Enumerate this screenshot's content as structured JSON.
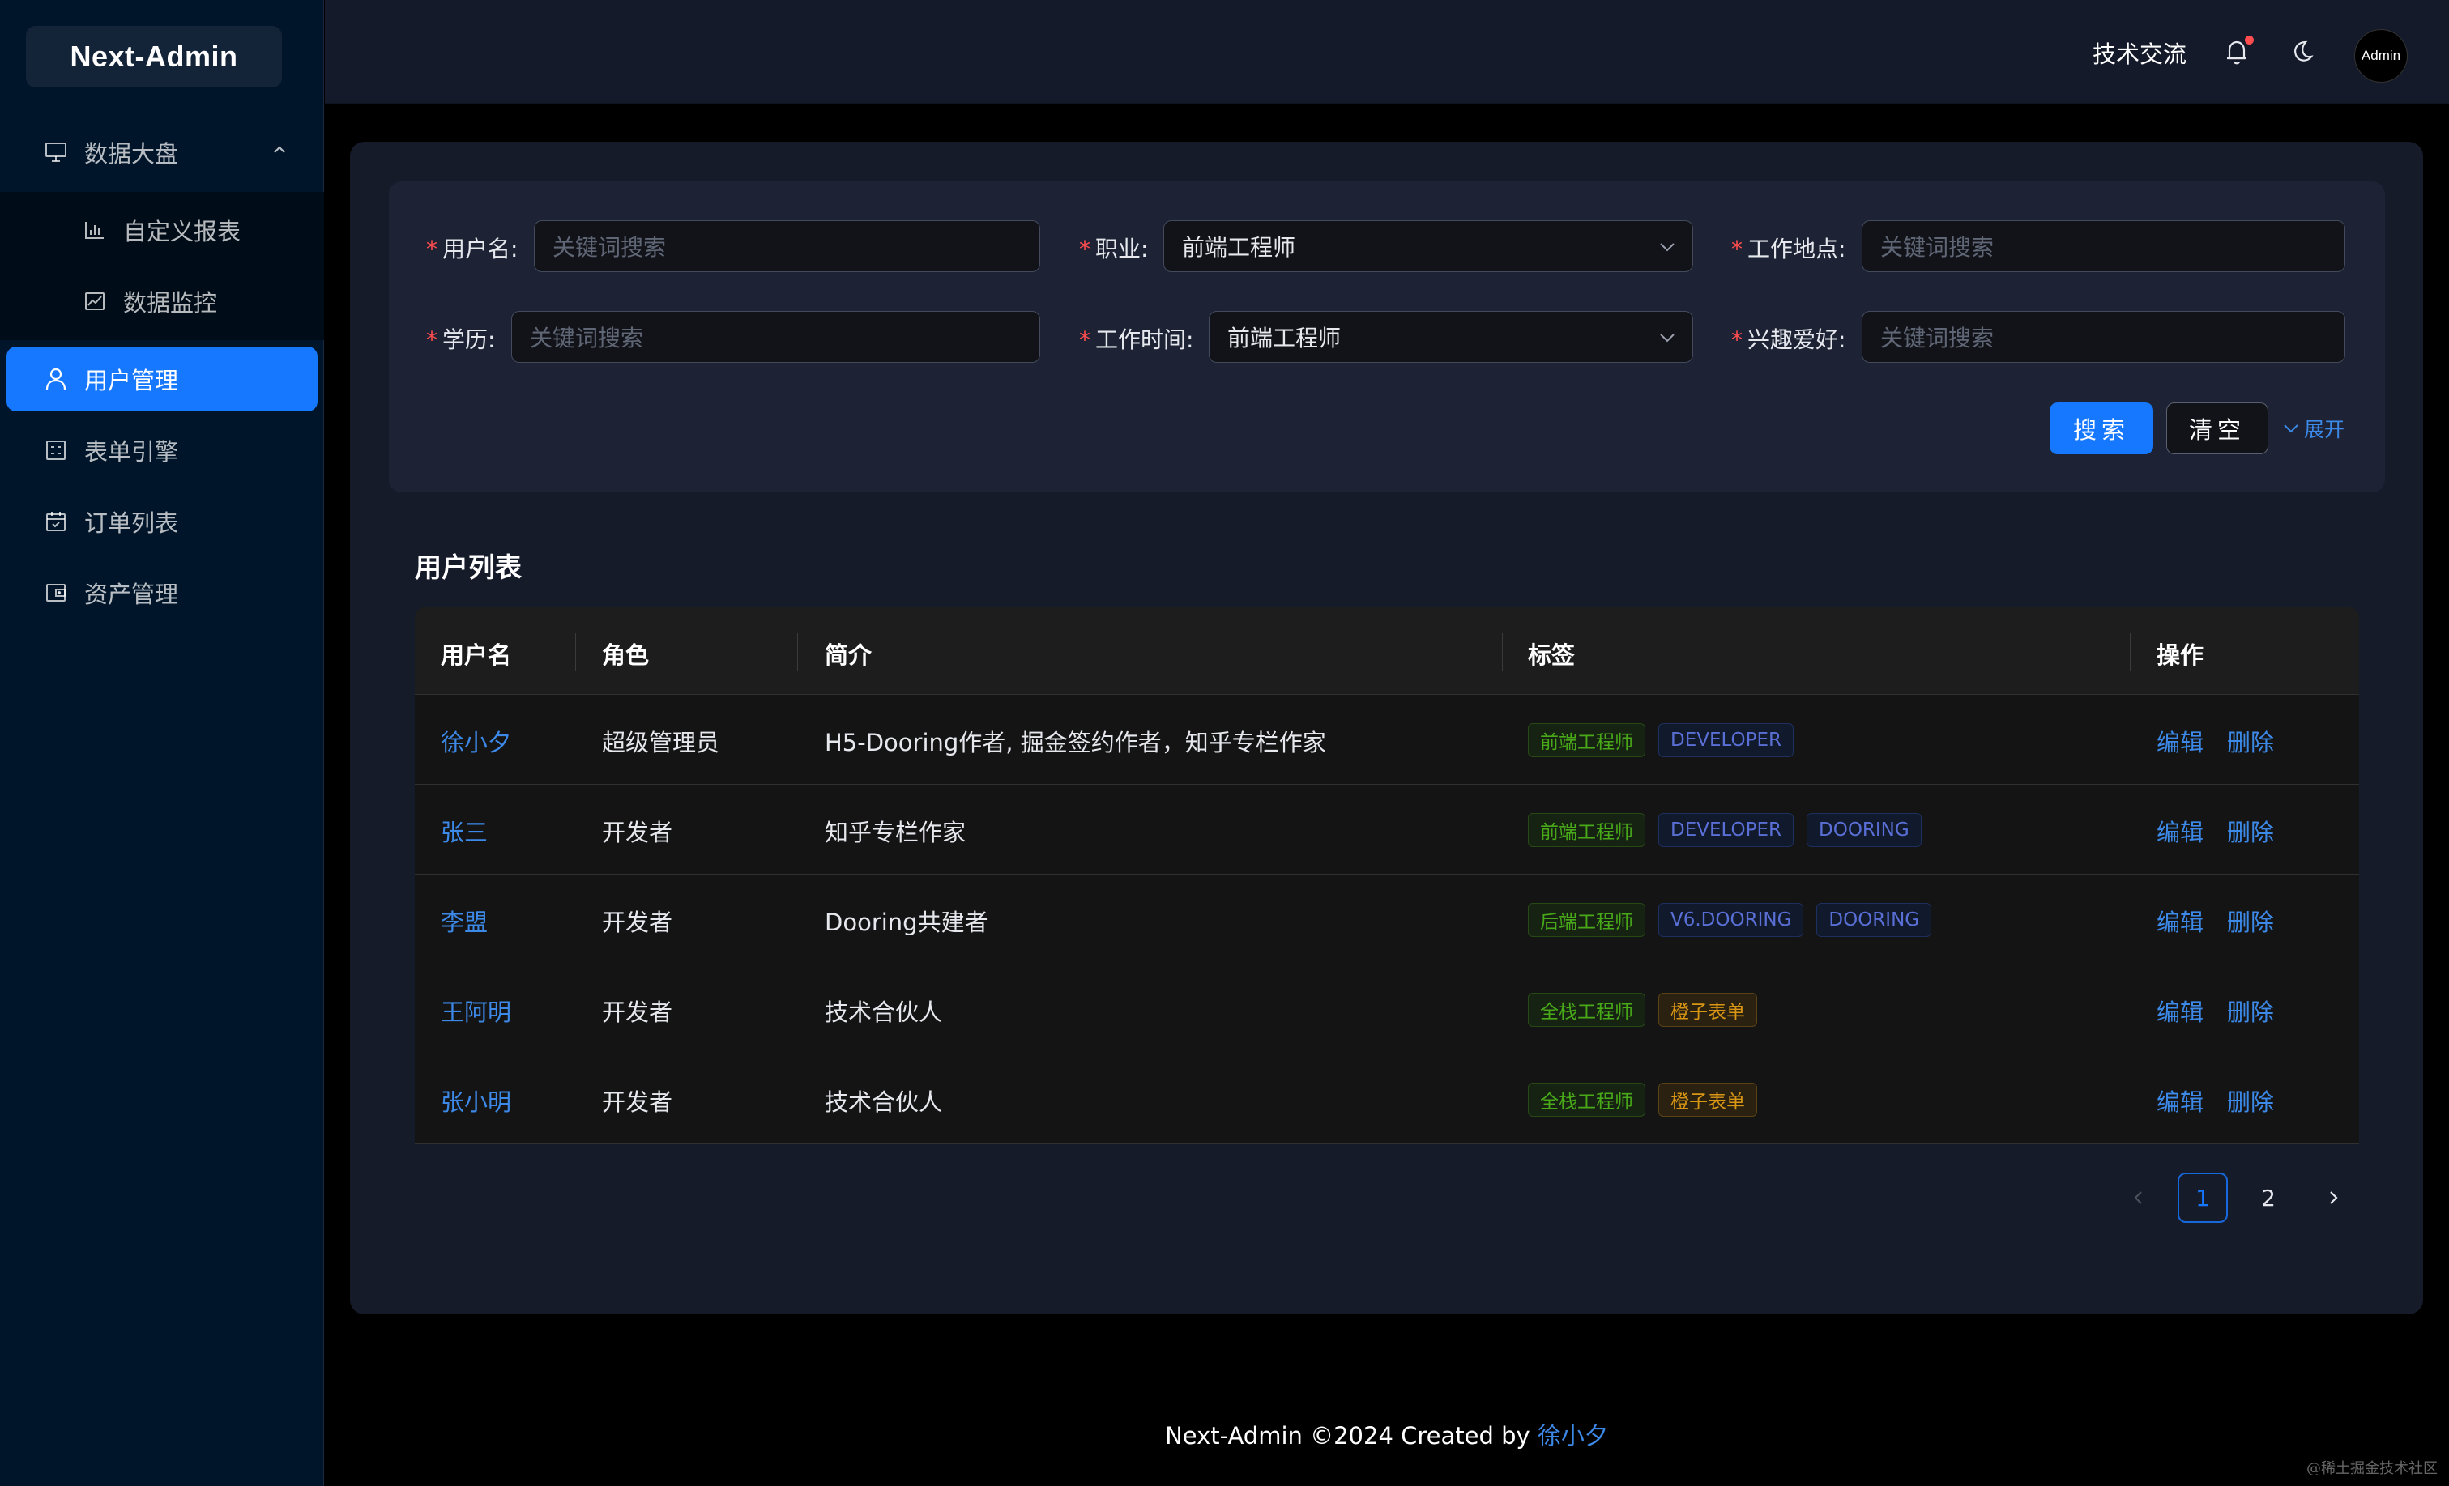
{
  "app": {
    "logo": "Next-Admin"
  },
  "sidebar": {
    "items": [
      {
        "label": "数据大盘",
        "icon": "monitor-icon"
      },
      {
        "label": "自定义报表",
        "icon": "bar-chart-icon"
      },
      {
        "label": "数据监控",
        "icon": "line-chart-icon"
      },
      {
        "label": "用户管理",
        "icon": "user-icon",
        "active": true
      },
      {
        "label": "表单引擎",
        "icon": "form-icon"
      },
      {
        "label": "订单列表",
        "icon": "calendar-icon"
      },
      {
        "label": "资产管理",
        "icon": "wallet-icon"
      }
    ]
  },
  "header": {
    "link": "技术交流",
    "avatar": "Admin",
    "icons": [
      "bell-icon",
      "moon-icon"
    ]
  },
  "filters": {
    "username": {
      "label": "用户名",
      "placeholder": "关键词搜索"
    },
    "job": {
      "label": "职业",
      "value": "前端工程师"
    },
    "location": {
      "label": "工作地点",
      "placeholder": "关键词搜索"
    },
    "education": {
      "label": "学历",
      "placeholder": "关键词搜索"
    },
    "work_time": {
      "label": "工作时间",
      "value": "前端工程师"
    },
    "hobby": {
      "label": "兴趣爱好",
      "placeholder": "关键词搜索"
    },
    "search_btn": "搜索",
    "clear_btn": "清空",
    "expand": "展开"
  },
  "table": {
    "title": "用户列表",
    "columns": [
      "用户名",
      "角色",
      "简介",
      "标签",
      "操作"
    ],
    "rows": [
      {
        "name": "徐小夕",
        "role": "超级管理员",
        "intro": "H5-Dooring作者, 掘金签约作者，知乎专栏作家",
        "tags": [
          [
            "前端工程师",
            "green"
          ],
          [
            "DEVELOPER",
            "blue"
          ]
        ]
      },
      {
        "name": "张三",
        "role": "开发者",
        "intro": "知乎专栏作家",
        "tags": [
          [
            "前端工程师",
            "green"
          ],
          [
            "DEVELOPER",
            "blue"
          ],
          [
            "DOORING",
            "blue"
          ]
        ]
      },
      {
        "name": "李盟",
        "role": "开发者",
        "intro": "Dooring共建者",
        "tags": [
          [
            "后端工程师",
            "green"
          ],
          [
            "V6.DOORING",
            "blue"
          ],
          [
            "DOORING",
            "blue"
          ]
        ]
      },
      {
        "name": "王阿明",
        "role": "开发者",
        "intro": "技术合伙人",
        "tags": [
          [
            "全栈工程师",
            "green"
          ],
          [
            "橙子表单",
            "gold"
          ]
        ]
      },
      {
        "name": "张小明",
        "role": "开发者",
        "intro": "技术合伙人",
        "tags": [
          [
            "全栈工程师",
            "green"
          ],
          [
            "橙子表单",
            "gold"
          ]
        ]
      }
    ],
    "actions": {
      "edit": "编辑",
      "delete": "删除"
    }
  },
  "pagination": {
    "pages": [
      "1",
      "2"
    ],
    "current": "1"
  },
  "footer": {
    "text": "Next-Admin ©2024 Created by ",
    "author": "徐小夕"
  },
  "watermark": "@稀土掘金技术社区",
  "colors": {
    "primary": "#1677ff",
    "sidebar": "#001529",
    "link": "#3c89e8",
    "required": "#ff4d4f"
  }
}
